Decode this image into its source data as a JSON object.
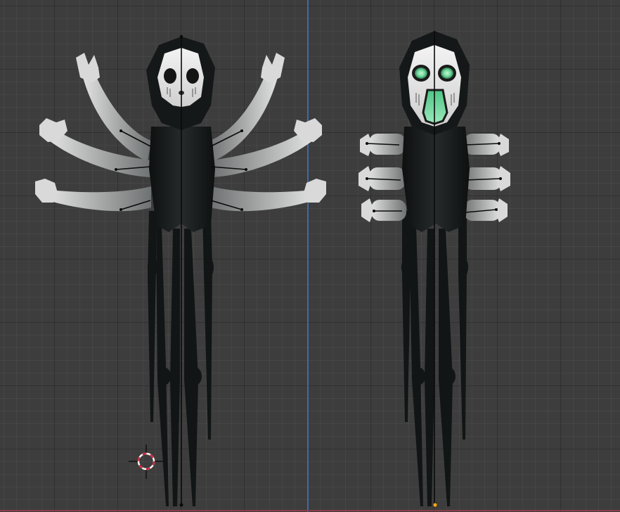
{
  "viewport": {
    "editor": "3d-viewport",
    "view": "front-orthographic",
    "colors": {
      "background": "#3d3d3d",
      "x_axis": "#8b3a48",
      "z_axis": "#3f6aa3",
      "cursor_red": "#d7263d",
      "body_dark": "#1b1e1e",
      "skin": "#c8c8c8",
      "mask": "#e8e8e8",
      "glow_green": "#7fd8a0",
      "origin_point": "#f5a623"
    }
  },
  "objects": [
    {
      "name": "spider-ghost-six-arms",
      "icon": "character-mesh"
    },
    {
      "name": "spider-ghost-short-arms",
      "icon": "character-mesh"
    }
  ],
  "cursor": {
    "icon": "3d-cursor-icon"
  }
}
